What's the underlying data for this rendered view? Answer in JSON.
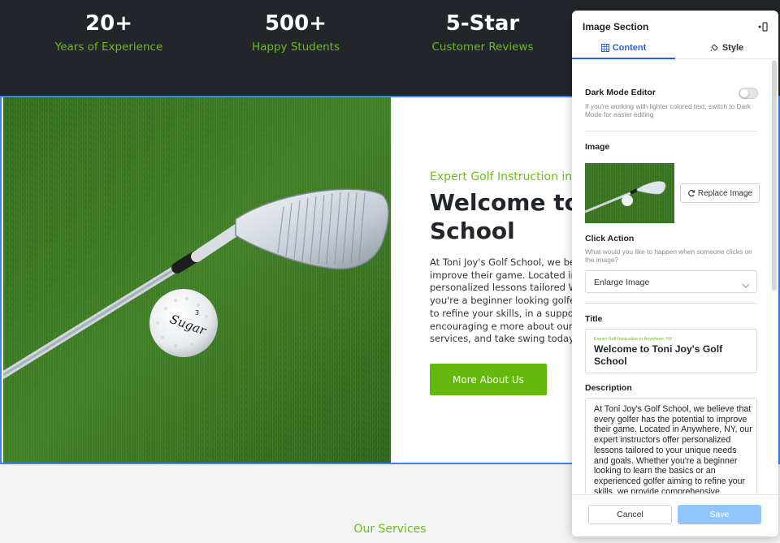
{
  "stats": [
    {
      "number": "20+",
      "label": "Years of Experience"
    },
    {
      "number": "500+",
      "label": "Happy Students"
    },
    {
      "number": "5-Star",
      "label": "Customer Reviews"
    }
  ],
  "hero": {
    "eyebrow": "Expert Golf Instruction in A",
    "headline": "Welcome to T School",
    "body": "At Toni Joy's Golf School, we believe improve their game. Located in An offer personalized lessons tailored Whether you're a beginner looking golfer aiming to refine your skills, in a supportive and encouraging e more about our services, and take swing today.",
    "button": "More About Us",
    "ball_brand": "Sugar",
    "ball_number": "3"
  },
  "services": {
    "title": "Our Services"
  },
  "panel": {
    "title": "Image Section",
    "tabs": {
      "content": "Content",
      "style": "Style"
    },
    "dark_mode": {
      "label": "Dark Mode Editor",
      "help": "If you're working with lighter colored text, switch to Dark Mode for easier editing",
      "enabled": false
    },
    "image": {
      "label": "Image",
      "replace_button": "Replace Image"
    },
    "click_action": {
      "label": "Click Action",
      "help": "What would you like to happen when someone clicks on the image?",
      "selected": "Enlarge Image"
    },
    "title_field": {
      "label": "Title",
      "eyebrow": "Expert Golf Instruction in Anywhere, NY",
      "value": "Welcome to Toni Joy's Golf School"
    },
    "description_field": {
      "label": "Description",
      "value": "At Toni Joy's Golf School, we believe that every golfer has the potential to improve their game. Located in Anywhere, NY, our expert instructors offer personalized lessons tailored to your unique needs and goals. Whether you're a beginner looking to learn the basics or an experienced golfer aiming to refine your skills, we provide comprehensive instruction in a"
    },
    "footer": {
      "cancel": "Cancel",
      "save": "Save"
    }
  },
  "colors": {
    "accent_green": "#6cbd1a",
    "button_green": "#65b80e",
    "dark_bg": "#22252a",
    "selection_blue": "#3b82f6",
    "tab_blue": "#2563eb",
    "save_disabled_blue": "#93c5fd"
  },
  "icons": {
    "collapse": "sidebar-collapse-icon",
    "content_tab": "grid-icon",
    "style_tab": "paint-bucket-icon",
    "replace": "refresh-icon",
    "dropdown": "chevron-down-icon"
  }
}
